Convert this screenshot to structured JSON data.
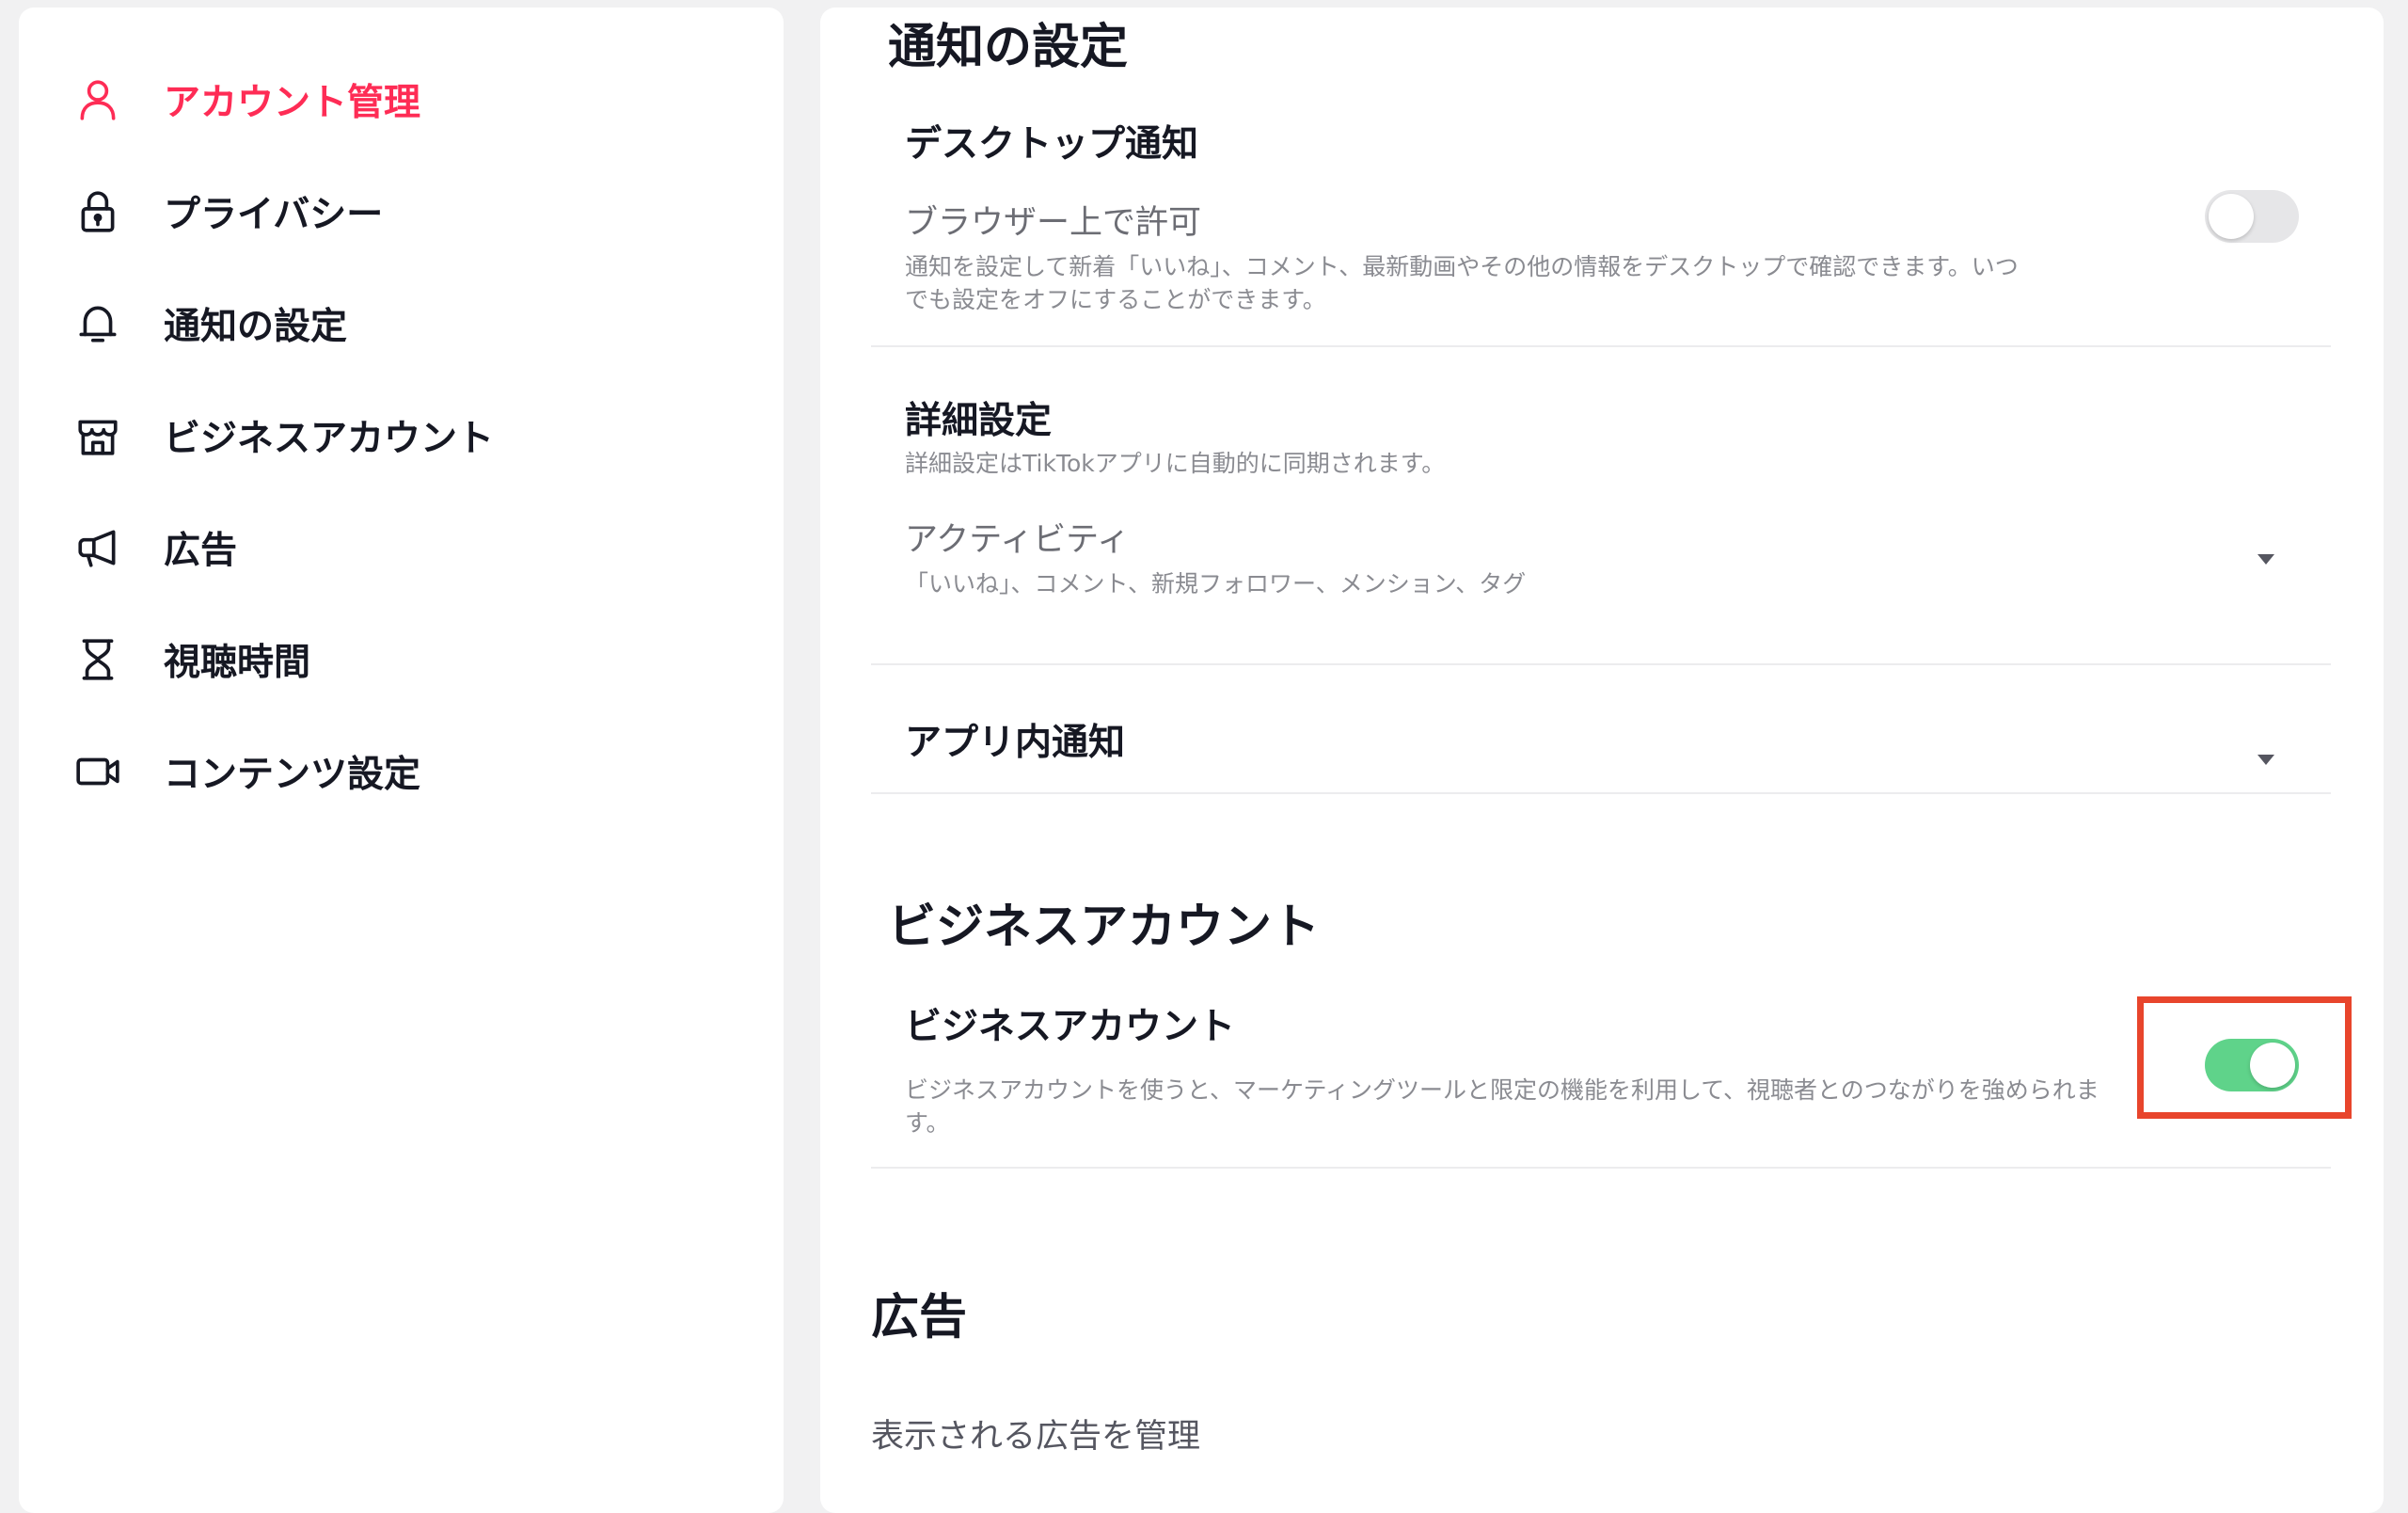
{
  "sidebar": {
    "items": [
      {
        "label": "アカウント管理",
        "icon": "person-icon",
        "active": true
      },
      {
        "label": "プライバシー",
        "icon": "lock-icon",
        "active": false
      },
      {
        "label": "通知の設定",
        "icon": "bell-icon",
        "active": false
      },
      {
        "label": "ビジネスアカウント",
        "icon": "store-icon",
        "active": false
      },
      {
        "label": "広告",
        "icon": "megaphone-icon",
        "active": false
      },
      {
        "label": "視聴時間",
        "icon": "hourglass-icon",
        "active": false
      },
      {
        "label": "コンテンツ設定",
        "icon": "video-camera-icon",
        "active": false
      }
    ]
  },
  "notifications": {
    "title": "通知の設定",
    "desktop": {
      "heading": "デスクトップ通知",
      "label": "ブラウザー上で許可",
      "description": "通知を設定して新着「いいね」、コメント、最新動画やその他の情報をデスクトップで確認できます。いつでも設定をオフにすることができます。",
      "enabled": false
    },
    "detail": {
      "heading": "詳細設定",
      "note": "詳細設定はTikTokアプリに自動的に同期されます。",
      "activity_label": "アクティビティ",
      "activity_summary": "「いいね」、コメント、新規フォロワー、メンション、タグ"
    },
    "in_app": {
      "heading": "アプリ内通知"
    }
  },
  "business": {
    "title": "ビジネスアカウント",
    "heading": "ビジネスアカウント",
    "description": "ビジネスアカウントを使うと、マーケティングツールと限定の機能を利用して、視聴者とのつながりを強められます。",
    "enabled": true
  },
  "ads": {
    "title": "広告",
    "manage_label": "表示される広告を管理"
  },
  "colors": {
    "accent": "#fe2c55",
    "toggle_on": "#5fd38a",
    "toggle_off": "#e6e6e8",
    "highlight": "#e8452c"
  }
}
